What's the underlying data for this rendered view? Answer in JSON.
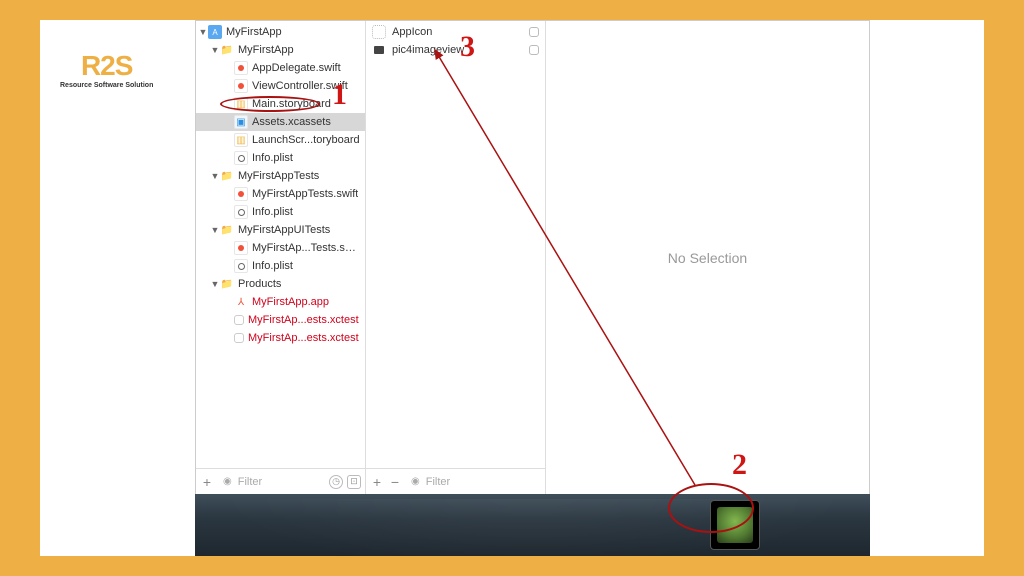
{
  "logo": {
    "text": "R2S",
    "sub": "Resource Software Solution"
  },
  "navigator": {
    "root": "MyFirstApp",
    "group1": "MyFirstApp",
    "items1": [
      "AppDelegate.swift",
      "ViewController.swift",
      "Main.storyboard",
      "Assets.xcassets",
      "LaunchScr...toryboard",
      "Info.plist"
    ],
    "group2": "MyFirstAppTests",
    "items2": [
      "MyFirstAppTests.swift",
      "Info.plist"
    ],
    "group3": "MyFirstAppUITests",
    "items3": [
      "MyFirstAp...Tests.swift",
      "Info.plist"
    ],
    "group4": "Products",
    "items4": [
      "MyFirstApp.app",
      "MyFirstAp...ests.xctest",
      "MyFirstAp...ests.xctest"
    ]
  },
  "filter_placeholder": "Filter",
  "assets": {
    "items": [
      {
        "name": "AppIcon"
      },
      {
        "name": "pic4imageview"
      }
    ]
  },
  "detail": {
    "noselection": "No Selection"
  },
  "annotations": {
    "n1": "1",
    "n2": "2",
    "n3": "3"
  }
}
